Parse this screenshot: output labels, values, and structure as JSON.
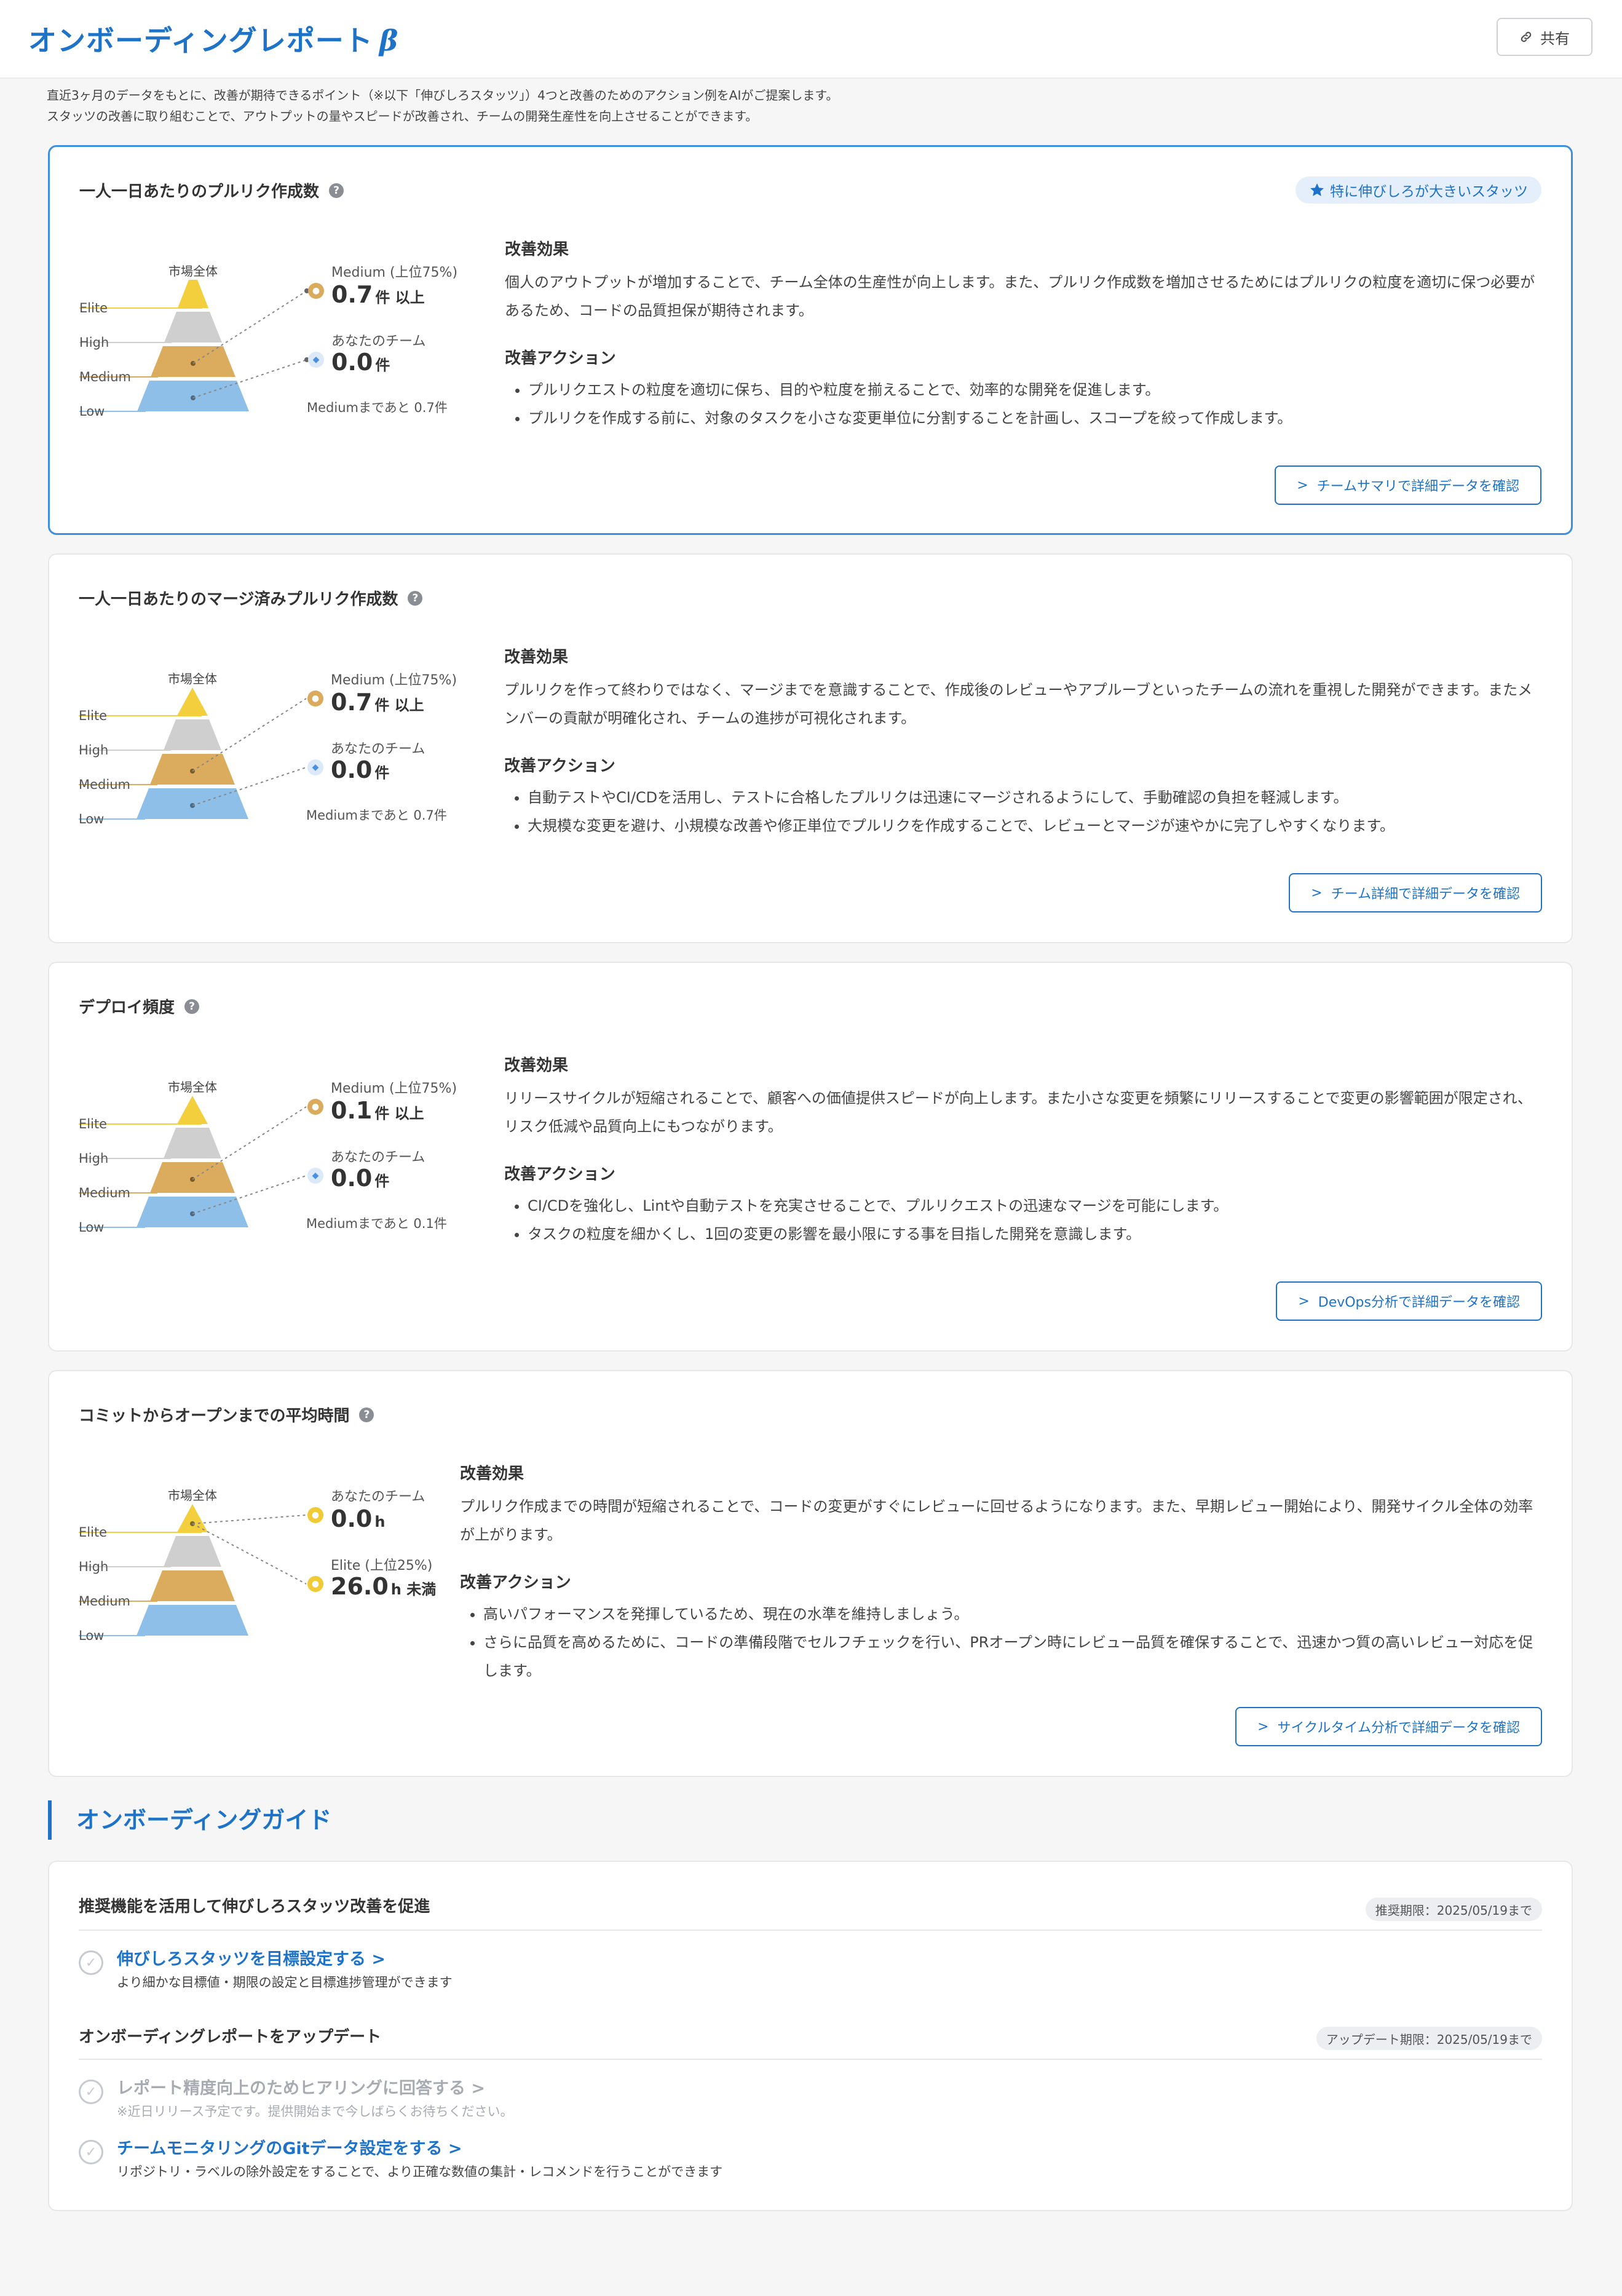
{
  "header": {
    "title": "オンボーディングレポート",
    "beta": "β",
    "share_label": "共有"
  },
  "intro": {
    "line1": "直近3ヶ月のデータをもとに、改善が期待できるポイント（※以下「伸びしろスタッツ」）4つと改善のためのアクション例をAIがご提案します。",
    "line2": "スタッツの改善に取り組むことで、アウトプットの量やスピードが改善され、チームの開発生産性を向上させることができます。"
  },
  "cards": [
    {
      "title": "一人一日あたりのプルリク作成数",
      "badge": "特に伸びしろが大きいスタッツ",
      "market_label": "市場全体",
      "levels": [
        "Elite",
        "High",
        "Medium",
        "Low"
      ],
      "label_a": "Medium (上位75%)",
      "value_a": "0.7",
      "unit_a": "件 以上",
      "label_b": "あなたのチーム",
      "value_b": "0.0",
      "unit_b": "件",
      "note": "Mediumまであと 0.7件",
      "effect_heading": "改善効果",
      "effect_text": "個人のアウトプットが増加することで、チーム全体の生産性が向上します。また、プルリク作成数を増加させるためにはプルリクの粒度を適切に保つ必要があるため、コードの品質担保が期待されます。",
      "action_heading": "改善アクション",
      "actions": [
        "プルリクエストの粒度を適切に保ち、目的や粒度を揃えることで、効率的な開発を促進します。",
        "プルリクを作成する前に、対象のタスクを小さな変更単位に分割することを計画し、スコープを絞って作成します。"
      ],
      "link_label": "チームサマリで詳細データを確認"
    },
    {
      "title": "一人一日あたりのマージ済みプルリク作成数",
      "market_label": "市場全体",
      "levels": [
        "Elite",
        "High",
        "Medium",
        "Low"
      ],
      "label_a": "Medium (上位75%)",
      "value_a": "0.7",
      "unit_a": "件 以上",
      "label_b": "あなたのチーム",
      "value_b": "0.0",
      "unit_b": "件",
      "note": "Mediumまであと 0.7件",
      "effect_heading": "改善効果",
      "effect_text": "プルリクを作って終わりではなく、マージまでを意識することで、作成後のレビューやアプルーブといったチームの流れを重視した開発ができます。またメンバーの貢献が明確化され、チームの進捗が可視化されます。",
      "action_heading": "改善アクション",
      "actions": [
        "自動テストやCI/CDを活用し、テストに合格したプルリクは迅速にマージされるようにして、手動確認の負担を軽減します。",
        "大規模な変更を避け、小規模な改善や修正単位でプルリクを作成することで、レビューとマージが速やかに完了しやすくなります。"
      ],
      "link_label": "チーム詳細で詳細データを確認"
    },
    {
      "title": "デプロイ頻度",
      "market_label": "市場全体",
      "levels": [
        "Elite",
        "High",
        "Medium",
        "Low"
      ],
      "label_a": "Medium (上位75%)",
      "value_a": "0.1",
      "unit_a": "件 以上",
      "label_b": "あなたのチーム",
      "value_b": "0.0",
      "unit_b": "件",
      "note": "Mediumまであと 0.1件",
      "effect_heading": "改善効果",
      "effect_text": "リリースサイクルが短縮されることで、顧客への価値提供スピードが向上します。また小さな変更を頻繁にリリースすることで変更の影響範囲が限定され、リスク低減や品質向上にもつながります。",
      "action_heading": "改善アクション",
      "actions": [
        "CI/CDを強化し、Lintや自動テストを充実させることで、プルリクエストの迅速なマージを可能にします。",
        "タスクの粒度を細かくし、1回の変更の影響を最小限にする事を目指した開発を意識します。"
      ],
      "link_label": "DevOps分析で詳細データを確認"
    },
    {
      "title": "コミットからオープンまでの平均時間",
      "market_label": "市場全体",
      "levels": [
        "Elite",
        "High",
        "Medium",
        "Low"
      ],
      "label_a": "あなたのチーム",
      "value_a": "0.0",
      "unit_a": "h",
      "label_b": "Elite (上位25%)",
      "value_b": "26.0",
      "unit_b": "h 未満",
      "effect_heading": "改善効果",
      "effect_text": "プルリク作成までの時間が短縮されることで、コードの変更がすぐにレビューに回せるようになります。また、早期レビュー開始により、開発サイクル全体の効率が上がります。",
      "action_heading": "改善アクション",
      "actions": [
        "高いパフォーマンスを発揮しているため、現在の水準を維持しましょう。",
        "さらに品質を高めるために、コードの準備段階でセルフチェックを行い、PRオープン時にレビュー品質を確保することで、迅速かつ質の高いレビュー対応を促します。"
      ],
      "link_label": "サイクルタイム分析で詳細データを確認"
    }
  ],
  "guide": {
    "heading": "オンボーディングガイド",
    "group1": {
      "title": "推奨機能を活用して伸びしろスタッツ改善を促進",
      "tag": "推奨期限：2025/05/19まで",
      "items": [
        {
          "link": "伸びしろスタッツを目標設定する",
          "desc": "より細かな目標値・期限の設定と目標進捗管理ができます"
        }
      ]
    },
    "group2": {
      "title": "オンボーディングレポートをアップデート",
      "tag": "アップデート期限：2025/05/19まで",
      "items": [
        {
          "link": "レポート精度向上のためヒアリングに回答する",
          "desc": "※近日リリース予定です。提供開始まで今しばらくお待ちください。"
        },
        {
          "link": "チームモニタリングのGitデータ設定をする",
          "desc": "リポジトリ・ラベルの除外設定をすることで、より正確な数値の集計・レコメンドを行うことができます"
        }
      ]
    }
  },
  "colors": {
    "accent": "#1e73c8",
    "elite": "#f3cf3e",
    "high": "#cfcfcf",
    "medium": "#dcac5e",
    "low": "#8dbfe8"
  }
}
